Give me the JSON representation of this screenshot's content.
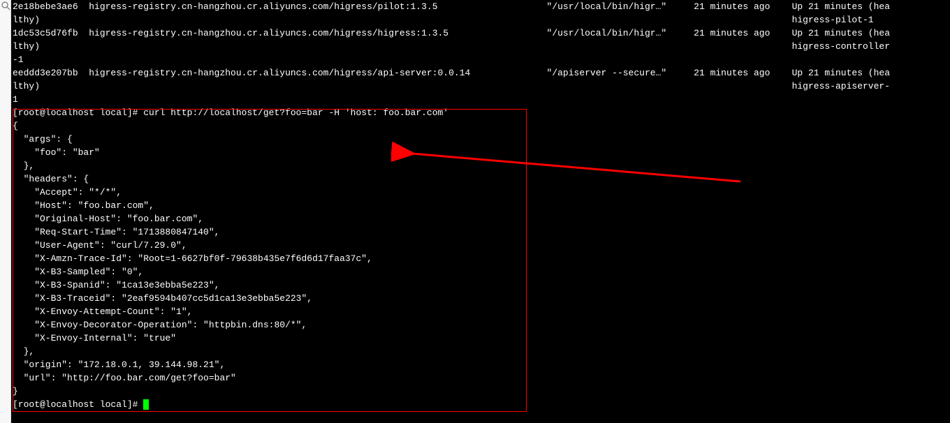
{
  "containers": [
    {
      "id": "2e18bebe3ae6",
      "image": "higress-registry.cn-hangzhou.cr.aliyuncs.com/higress/pilot:1.3.5",
      "cmd": "\"/usr/local/bin/higr…\"",
      "created": "21 minutes ago",
      "status_a": "Up 21 minutes (hea",
      "wrap_a": "lthy)",
      "status_b": "higress-pilot-1",
      "wrap_b": ""
    },
    {
      "id": "1dc53c5d76fb",
      "image": "higress-registry.cn-hangzhou.cr.aliyuncs.com/higress/higress:1.3.5",
      "cmd": "\"/usr/local/bin/higr…\"",
      "created": "21 minutes ago",
      "status_a": "Up 21 minutes (hea",
      "wrap_a": "lthy)",
      "status_b": "higress-controller",
      "wrap_b": "-1"
    },
    {
      "id": "eeddd3e207bb",
      "image": "higress-registry.cn-hangzhou.cr.aliyuncs.com/higress/api-server:0.0.14",
      "cmd": "\"/apiserver --secure…\"",
      "created": "21 minutes ago",
      "status_a": "Up 21 minutes (hea",
      "wrap_a": "lthy)",
      "status_b": "higress-apiserver-",
      "wrap_b": "1"
    }
  ],
  "prompt": "[root@localhost local]#",
  "curl_cmd": "curl http://localhost/get?foo=bar -H 'host: foo.bar.com'",
  "json_lines": [
    "{",
    "  \"args\": {",
    "    \"foo\": \"bar\"",
    "  },",
    "  \"headers\": {",
    "    \"Accept\": \"*/*\",",
    "    \"Host\": \"foo.bar.com\",",
    "    \"Original-Host\": \"foo.bar.com\",",
    "    \"Req-Start-Time\": \"1713880847140\",",
    "    \"User-Agent\": \"curl/7.29.0\",",
    "    \"X-Amzn-Trace-Id\": \"Root=1-6627bf0f-79638b435e7f6d6d17faa37c\",",
    "    \"X-B3-Sampled\": \"0\",",
    "    \"X-B3-Spanid\": \"1ca13e3ebba5e223\",",
    "    \"X-B3-Traceid\": \"2eaf9594b407cc5d1ca13e3ebba5e223\",",
    "    \"X-Envoy-Attempt-Count\": \"1\",",
    "    \"X-Envoy-Decorator-Operation\": \"httpbin.dns:80/*\",",
    "    \"X-Envoy-Internal\": \"true\"",
    "  },",
    "  \"origin\": \"172.18.0.1, 39.144.98.21\",",
    "  \"url\": \"http://foo.bar.com/get?foo=bar\"",
    "}"
  ]
}
